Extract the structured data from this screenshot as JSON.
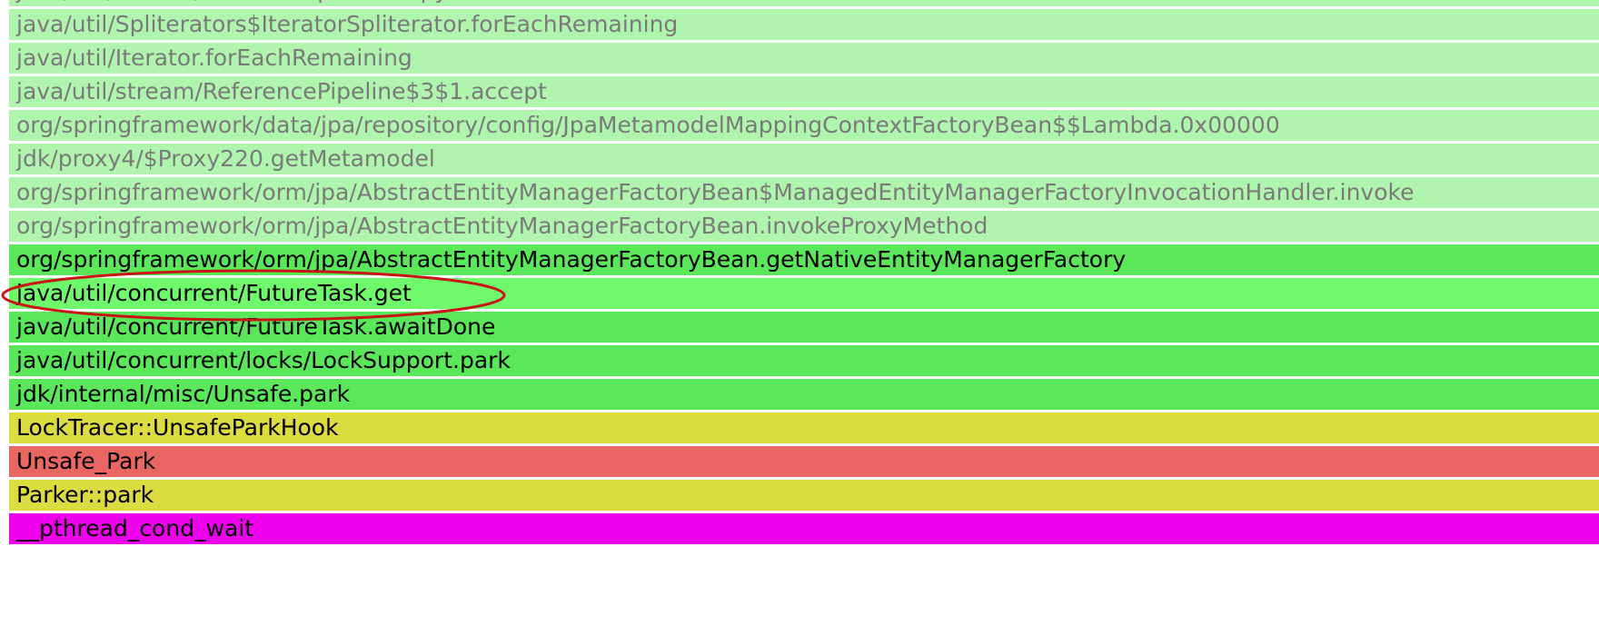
{
  "frames": [
    {
      "label": "java/util/stream/AbstractPipeline.copyInto",
      "kind": "dim"
    },
    {
      "label": "java/util/Spliterators$IteratorSpliterator.forEachRemaining",
      "kind": "dim"
    },
    {
      "label": "java/util/Iterator.forEachRemaining",
      "kind": "dim"
    },
    {
      "label": "java/util/stream/ReferencePipeline$3$1.accept",
      "kind": "dim"
    },
    {
      "label": "org/springframework/data/jpa/repository/config/JpaMetamodelMappingContextFactoryBean$$Lambda.0x00000",
      "kind": "dim"
    },
    {
      "label": "jdk/proxy4/$Proxy220.getMetamodel",
      "kind": "dim"
    },
    {
      "label": "org/springframework/orm/jpa/AbstractEntityManagerFactoryBean$ManagedEntityManagerFactoryInvocationHandler.invoke",
      "kind": "dim"
    },
    {
      "label": "org/springframework/orm/jpa/AbstractEntityManagerFactoryBean.invokeProxyMethod",
      "kind": "dim"
    },
    {
      "label": "org/springframework/orm/jpa/AbstractEntityManagerFactoryBean.getNativeEntityManagerFactory",
      "kind": "green"
    },
    {
      "label": "java/util/concurrent/FutureTask.get",
      "kind": "hl"
    },
    {
      "label": "java/util/concurrent/FutureTask.awaitDone",
      "kind": "green"
    },
    {
      "label": "java/util/concurrent/locks/LockSupport.park",
      "kind": "green"
    },
    {
      "label": "jdk/internal/misc/Unsafe.park",
      "kind": "green"
    },
    {
      "label": "LockTracer::UnsafeParkHook",
      "kind": "yellow"
    },
    {
      "label": "Unsafe_Park",
      "kind": "red"
    },
    {
      "label": "Parker::park",
      "kind": "yellow"
    },
    {
      "label": "__pthread_cond_wait",
      "kind": "mag"
    }
  ],
  "annotation_color": "#cc1111"
}
